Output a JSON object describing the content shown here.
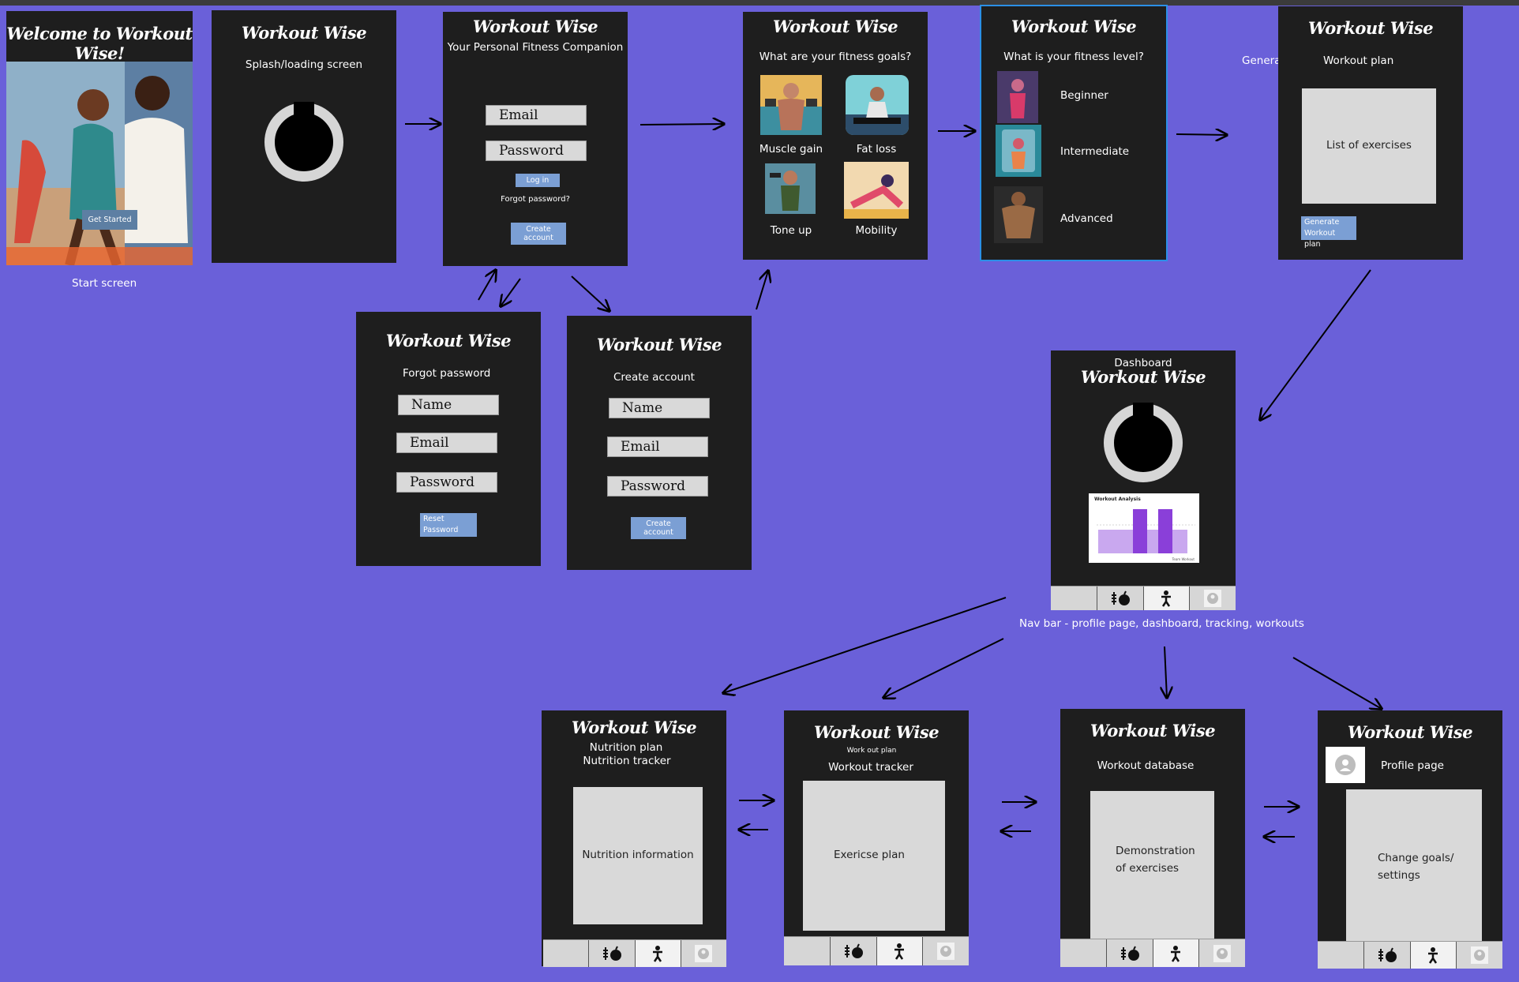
{
  "canvas": {
    "background": "#6a60d9",
    "frame_color": "#1e1e1e",
    "button_color": "#7b9fd4",
    "placeholder_color": "#d9d9d9",
    "selection_color": "#2b8fe6"
  },
  "start": {
    "title": "Welcome to Workout Wise!",
    "button": "Get Started",
    "caption": "Start screen"
  },
  "splash": {
    "title": "Workout Wise",
    "subtitle": "Splash/loading screen"
  },
  "login": {
    "title": "Workout Wise",
    "tagline": "Your Personal Fitness Companion",
    "email": "Email",
    "password": "Password",
    "login_button": "Log in",
    "forgot_link": "Forgot password?",
    "create_button": "Create account"
  },
  "goals": {
    "title": "Workout Wise",
    "question": "What are your fitness goals?",
    "options": [
      "Muscle gain",
      "Fat loss",
      "Tone up",
      "Mobility"
    ]
  },
  "level": {
    "title": "Workout Wise",
    "question": "What is your fitness level?",
    "options": [
      "Beginner",
      "Intermediate",
      "Advanced"
    ]
  },
  "plan": {
    "title": "Workout Wise",
    "cut_label": "Genera",
    "subtitle": "Workout plan",
    "list": "List of exercises",
    "button_line1": "Generate",
    "button_line2": "Workout plan"
  },
  "forgot": {
    "title": "Workout Wise",
    "subtitle": "Forgot password",
    "name": "Name",
    "email": "Email",
    "password": "Password",
    "button_line1": "Reset",
    "button_line2": "Password"
  },
  "create": {
    "title": "Workout Wise",
    "subtitle": "Create account",
    "name": "Name",
    "email": "Email",
    "password": "Password",
    "button": "Create account"
  },
  "dashboard": {
    "label": "Dashboard",
    "title": "Workout Wise",
    "chart_title": "Workout Analysis",
    "chart_footer": "Team Workout",
    "nav_caption": "Nav bar - profile page, dashboard, tracking, workouts"
  },
  "nutrition": {
    "title": "Workout Wise",
    "line1": "Nutrition plan",
    "line2": "Nutrition tracker",
    "box": "Nutrition information"
  },
  "tracker": {
    "title": "Workout Wise",
    "small": "Work out plan",
    "subtitle": "Workout tracker",
    "box": "Exericse plan"
  },
  "database": {
    "title": "Workout Wise",
    "subtitle": "Workout database",
    "box_line1": "Demonstration",
    "box_line2": "of exercises"
  },
  "profile": {
    "title": "Workout Wise",
    "subtitle": "Profile page",
    "box_line1": "Change goals/",
    "box_line2": "settings"
  },
  "icons": [
    "nutrition-icon",
    "fitness-icon",
    "avatar-icon"
  ]
}
